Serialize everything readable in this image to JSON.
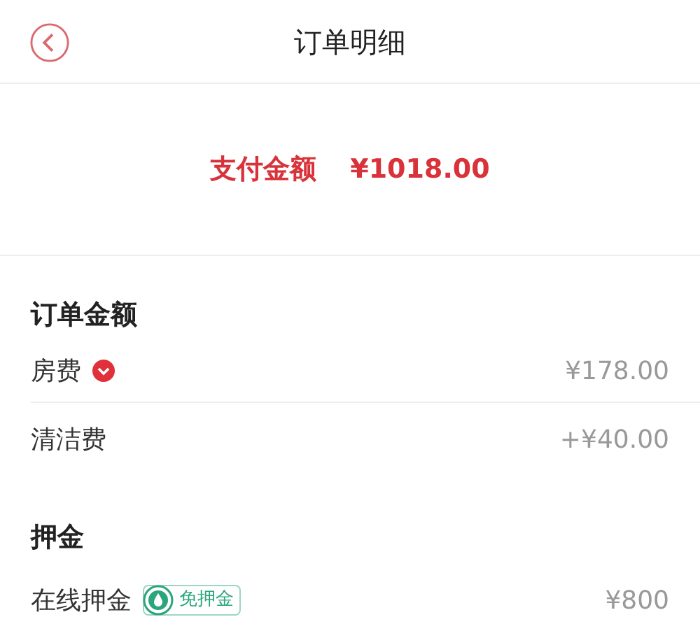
{
  "header": {
    "title": "订单明细"
  },
  "payment": {
    "label": "支付金额",
    "amount": "¥1018.00"
  },
  "sections": [
    {
      "title": "订单金额",
      "rows": [
        {
          "label": "房费",
          "value": "¥178.00",
          "dropdown": true
        },
        {
          "label": "清洁费",
          "value": "+¥40.00",
          "dropdown": false
        }
      ]
    },
    {
      "title": "押金",
      "rows": [
        {
          "label": "在线押金",
          "value": "¥800",
          "badge": "免押金",
          "dropdown": false
        }
      ]
    }
  ]
}
